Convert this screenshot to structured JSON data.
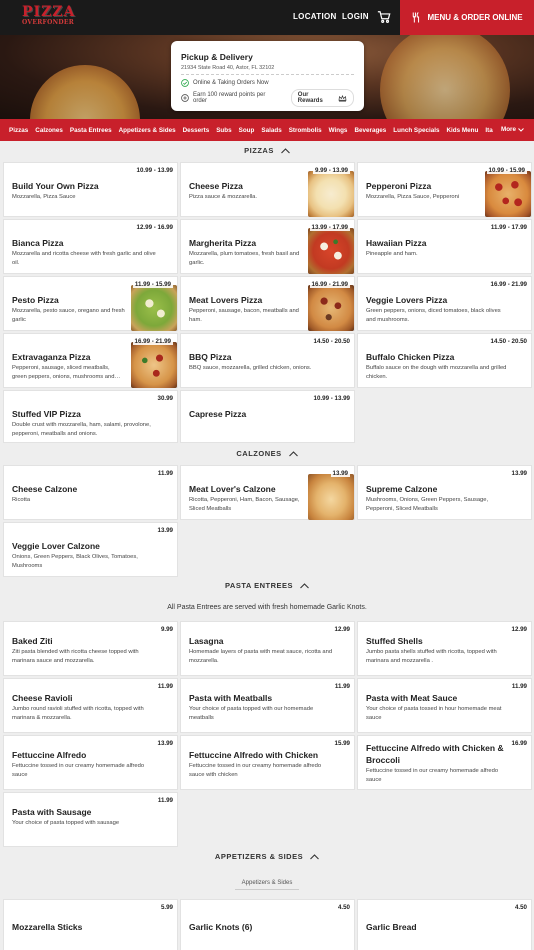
{
  "header": {
    "logo_line1": "PIZZA",
    "logo_line2": "OVERFONDER",
    "nav": {
      "location": "LOCATION",
      "login": "LOGIN"
    },
    "cta": "MENU & ORDER ONLINE"
  },
  "store": {
    "title": "Pickup & Delivery",
    "address": "21934 State Road 40, Astor, FL 32102",
    "status": "Online & Taking Orders Now",
    "rewards_text": "Earn 100 reward points per order",
    "rewards_button": "Our Rewards"
  },
  "categories": [
    "Pizzas",
    "Calzones",
    "Pasta Entrees",
    "Appetizers & Sides",
    "Desserts",
    "Subs",
    "Soup",
    "Salads",
    "Strombolis",
    "Wings",
    "Beverages",
    "Lunch Specials",
    "Kids Menu",
    "Ita"
  ],
  "more_label": "More",
  "sections": {
    "pizzas": {
      "title": "PIZZAS",
      "items": [
        {
          "name": "Build Your Own Pizza",
          "desc": "Mozzarella, Pizza Sauce",
          "price": "10.99 - 13.99",
          "img": ""
        },
        {
          "name": "Cheese Pizza",
          "desc": "Pizza sauce & mozzarella.",
          "price": "9.99 - 13.99",
          "img": "cheese"
        },
        {
          "name": "Pepperoni Pizza",
          "desc": "Mozzarella, Pizza Sauce, Pepperoni",
          "price": "10.99 - 15.99",
          "img": "pepperoni"
        },
        {
          "name": "Bianca Pizza",
          "desc": "Mozzarella and ricotta cheese with fresh garlic and olive oil.",
          "price": "12.99 - 16.99",
          "img": ""
        },
        {
          "name": "Margherita Pizza",
          "desc": "Mozzarella, plum tomatoes, fresh basil and garlic.",
          "price": "13.99 - 17.99",
          "img": "margherita"
        },
        {
          "name": "Hawaiian Pizza",
          "desc": "Pineapple and ham.",
          "price": "11.99 - 17.99",
          "img": ""
        },
        {
          "name": "Pesto Pizza",
          "desc": "Mozzarella, pesto sauce, oregano and fresh garlic",
          "price": "11.99 - 15.99",
          "img": "pesto"
        },
        {
          "name": "Meat Lovers Pizza",
          "desc": "Pepperoni, sausage, bacon, meatballs and ham.",
          "price": "16.99 - 21.99",
          "img": "meat"
        },
        {
          "name": "Veggie Lovers Pizza",
          "desc": "Green peppers, onions, diced tomatoes, black olives and mushrooms.",
          "price": "16.99 - 21.99",
          "img": ""
        },
        {
          "name": "Extravaganza Pizza",
          "desc": "Pepperoni, sausage, sliced meatballs, green peppers, onions, mushrooms and…",
          "price": "16.99 - 21.99",
          "img": "extra"
        },
        {
          "name": "BBQ Pizza",
          "desc": "BBQ sauce, mozzarella, grilled chicken, onions.",
          "price": "14.50 - 20.50",
          "img": ""
        },
        {
          "name": "Buffalo Chicken Pizza",
          "desc": "Buffalo sauce on the dough with mozzarella and grilled chicken.",
          "price": "14.50 - 20.50",
          "img": ""
        },
        {
          "name": "Stuffed VIP Pizza",
          "desc": "Double crust with mozzarella, ham, salami, provolone, pepperoni, meatballs and onions.",
          "price": "30.99",
          "img": ""
        },
        {
          "name": "Caprese Pizza",
          "desc": "",
          "price": "10.99 - 13.99",
          "img": ""
        }
      ]
    },
    "calzones": {
      "title": "CALZONES",
      "items": [
        {
          "name": "Cheese Calzone",
          "desc": "Ricotta",
          "price": "11.99",
          "img": ""
        },
        {
          "name": "Meat Lover's Calzone",
          "desc": "Ricotta, Pepperoni, Ham, Bacon, Sausage, Sliced Meatballs",
          "price": "13.99",
          "img": "calzone"
        },
        {
          "name": "Supreme Calzone",
          "desc": "Mushrooms, Onions, Green Peppers, Sausage, Pepperoni, Sliced Meatballs",
          "price": "13.99",
          "img": ""
        },
        {
          "name": "Veggie Lover Calzone",
          "desc": "Onions, Green Peppers, Black Olives, Tomatoes, Mushrooms",
          "price": "13.99",
          "img": ""
        }
      ]
    },
    "pasta": {
      "title": "PASTA ENTREES",
      "note": "All Pasta Entrees are served with fresh homemade Garlic Knots.",
      "items": [
        {
          "name": "Baked Ziti",
          "desc": "Ziti pasta blended with ricotta cheese topped with marinara sauce and mozzarella.",
          "price": "9.99"
        },
        {
          "name": "Lasagna",
          "desc": "Homemade layers of pasta with meat sauce, ricotta and mozzarella.",
          "price": "12.99"
        },
        {
          "name": "Stuffed Shells",
          "desc": "Jumbo pasta shells stuffed with ricotta, topped with marinara and mozzarella .",
          "price": "12.99"
        },
        {
          "name": "Cheese Ravioli",
          "desc": "Jumbo round ravioli stuffed with ricotta, topped with marinara & mozzarella.",
          "price": "11.99"
        },
        {
          "name": "Pasta with Meatballs",
          "desc": "Your choice of pasta topped with our homemade meatballs",
          "price": "11.99"
        },
        {
          "name": "Pasta with Meat Sauce",
          "desc": "Your choice of pasta tossed in hour homemade meat sauce",
          "price": "11.99"
        },
        {
          "name": "Fettuccine Alfredo",
          "desc": "Fettuccine tossed in our creamy homemade alfredo sauce",
          "price": "13.99"
        },
        {
          "name": "Fettuccine Alfredo with Chicken",
          "desc": "Fettuccine tossed in our creamy homemade alfredo sauce with chicken",
          "price": "15.99"
        },
        {
          "name": "Fettuccine Alfredo with Chicken & Broccoli",
          "desc": "Fettuccine tossed in our creamy homemade alfredo sauce",
          "price": "16.99"
        },
        {
          "name": "Pasta with Sausage",
          "desc": "Your choice of pasta topped with sausage",
          "price": "11.99"
        }
      ]
    },
    "appetizers": {
      "title": "APPETIZERS & SIDES",
      "subtab": "Appetizers & Sides",
      "items": [
        {
          "name": "Mozzarella Sticks",
          "price": "5.99"
        },
        {
          "name": "Garlic Knots (6)",
          "price": "4.50"
        },
        {
          "name": "Garlic Bread",
          "price": "4.50"
        }
      ]
    }
  },
  "colors": {
    "brand_red": "#c8202b",
    "header_bg": "#1a1a1a",
    "page_bg": "#eeeeee"
  }
}
